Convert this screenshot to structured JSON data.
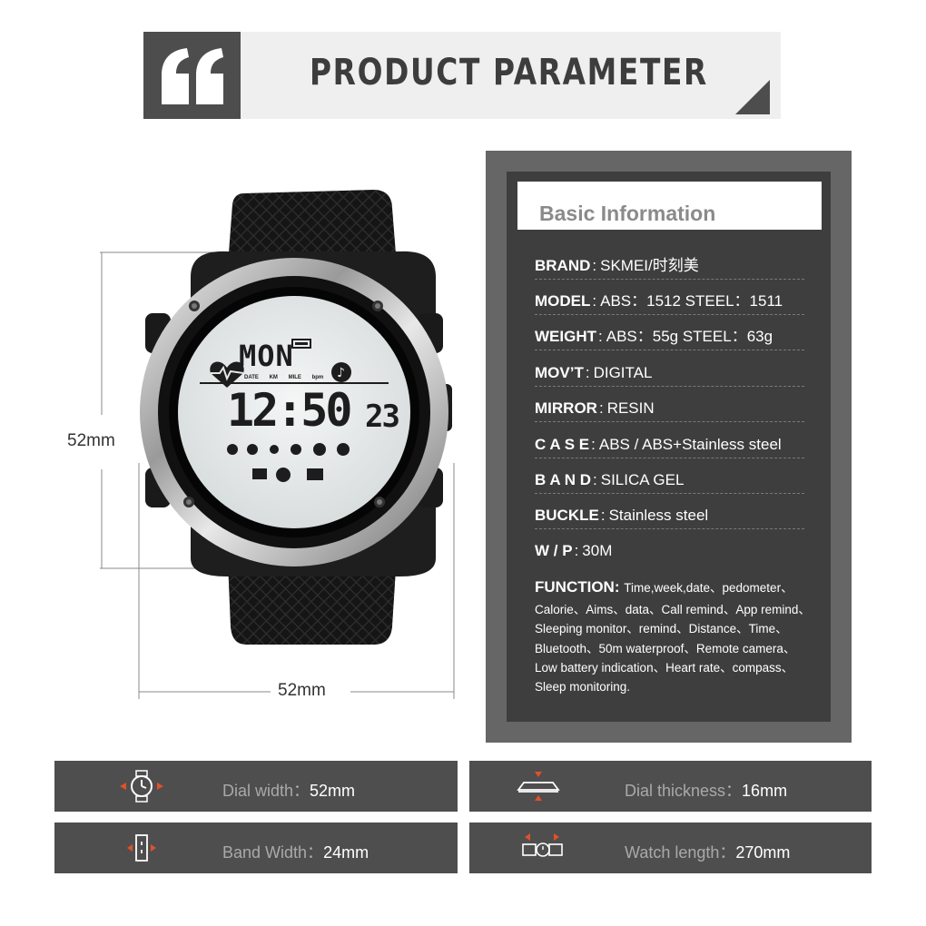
{
  "header": {
    "title": "PRODUCT PARAMETER"
  },
  "dimensions": {
    "height": "52mm",
    "width": "52mm"
  },
  "watch_display": {
    "day": "MON",
    "time": "12:50",
    "seconds": "23",
    "small_labels": [
      "DATE",
      "KM",
      "MILE",
      "bpm"
    ]
  },
  "info": {
    "title": "Basic Information",
    "rows": [
      {
        "label": "BRAND",
        "value": "SKMEI/时刻美"
      },
      {
        "label": "MODEL",
        "value": "ABS：1512    STEEL：1511"
      },
      {
        "label": "WEIGHT",
        "value": "ABS：55g    STEEL：63g"
      },
      {
        "label": "MOV’T",
        "value": "DIGITAL"
      },
      {
        "label": "MIRROR",
        "value": "RESIN"
      },
      {
        "label": "C A S E",
        "value": "ABS  /  ABS+Stainless steel"
      },
      {
        "label": "B A N D",
        "value": "SILICA GEL"
      },
      {
        "label": "BUCKLE",
        "value": "Stainless steel"
      },
      {
        "label": "W  /  P",
        "value": "30M"
      }
    ],
    "function": {
      "label": "FUNCTION",
      "lines": [
        "Time,week,date、pedometer、",
        "Calorie、Aims、data、Call remind、App remind、",
        "Sleeping monitor、remind、Distance、Time、",
        "Bluetooth、50m waterproof、Remote camera、",
        "Low battery indication、Heart rate、compass、",
        "Sleep monitoring."
      ]
    }
  },
  "specs": [
    {
      "label": "Dial width：",
      "value": "52mm",
      "icon": "dial-width-icon"
    },
    {
      "label": "Dial thickness：",
      "value": "16mm",
      "icon": "dial-thickness-icon"
    },
    {
      "label": "Band Width：",
      "value": "24mm",
      "icon": "band-width-icon"
    },
    {
      "label": "Watch length：",
      "value": "270mm",
      "icon": "watch-length-icon"
    }
  ],
  "colors": {
    "panel_dark": "#3e3e3e",
    "panel_mid": "#666666",
    "accent": "#e0512a",
    "header_bg": "#efefef"
  }
}
